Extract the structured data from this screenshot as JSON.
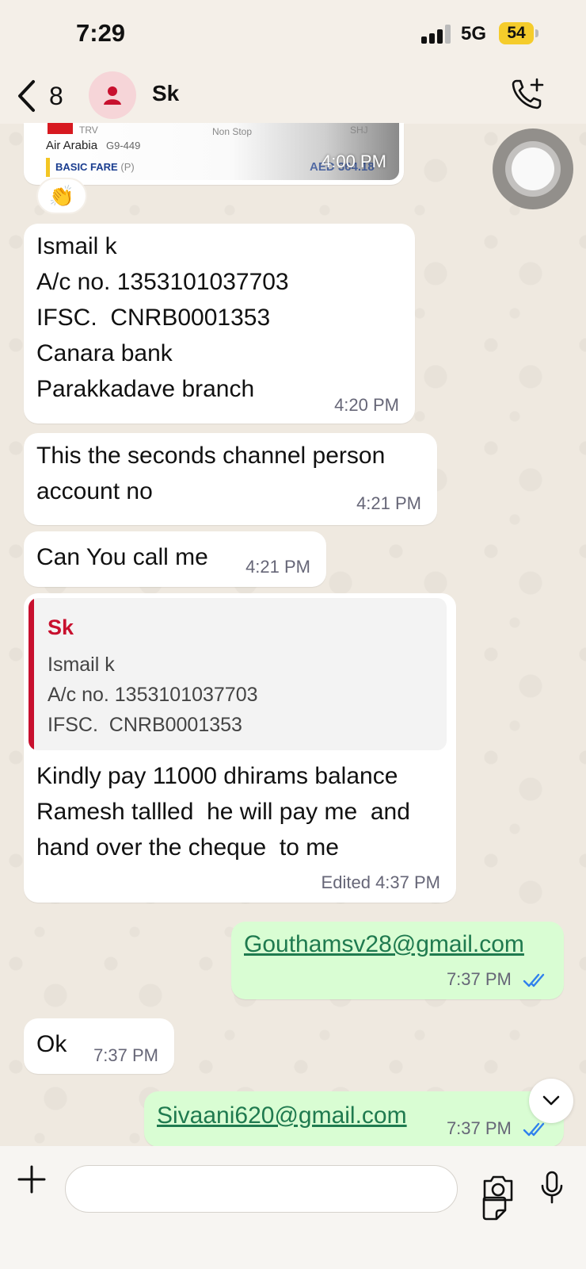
{
  "status_bar": {
    "time": "7:29",
    "network": "5G",
    "battery": "54"
  },
  "header": {
    "back_count": "8",
    "contact_name": "Sk"
  },
  "flight_card": {
    "origin": "TRV",
    "stop_type": "Non Stop",
    "destination": "SHJ",
    "airline": "Air Arabia",
    "flight_no": "G9-449",
    "fare_type": "BASIC FARE",
    "fare_suffix": "(P)",
    "price": "AED 364.18",
    "time": "4:00 PM",
    "reaction": "👏"
  },
  "messages": [
    {
      "direction": "in",
      "text": "Ismail k\nA/c no. 1353101037703\nIFSC.  CNRB0001353\nCanara bank\nParakkadave branch",
      "time": "4:20 PM"
    },
    {
      "direction": "in",
      "text": "This the seconds channel person\naccount no",
      "time": "4:21 PM"
    },
    {
      "direction": "in",
      "text": "Can You call me",
      "time": "4:21 PM"
    },
    {
      "direction": "in",
      "quote": {
        "author": "Sk",
        "lines": [
          "Ismail k",
          "A/c no. 1353101037703",
          "IFSC.  CNRB0001353"
        ]
      },
      "text": "Kindly pay 11000 dhirams balance\nRamesh tallled  he will pay me  and\nhand over the cheque  to me",
      "edited": "Edited",
      "time": "4:37 PM"
    },
    {
      "direction": "out",
      "text": "Gouthamsv28@gmail.com",
      "time": "7:37 PM"
    },
    {
      "direction": "in",
      "text": "Ok",
      "time": "7:37 PM"
    },
    {
      "direction": "out",
      "text": "Sivaani620@gmail.com",
      "time": "7:37 PM"
    }
  ],
  "colors": {
    "accent_quote": "#c8102e",
    "outgoing_bubble": "#d9fdd3",
    "read_ticks": "#2f80ed",
    "battery": "#f5cc2b"
  },
  "icons": [
    "back-chevron-icon",
    "person-icon",
    "call-add-icon",
    "chevron-down-icon",
    "plus-icon",
    "sticker-icon",
    "camera-icon",
    "mic-icon",
    "double-check-icon"
  ]
}
